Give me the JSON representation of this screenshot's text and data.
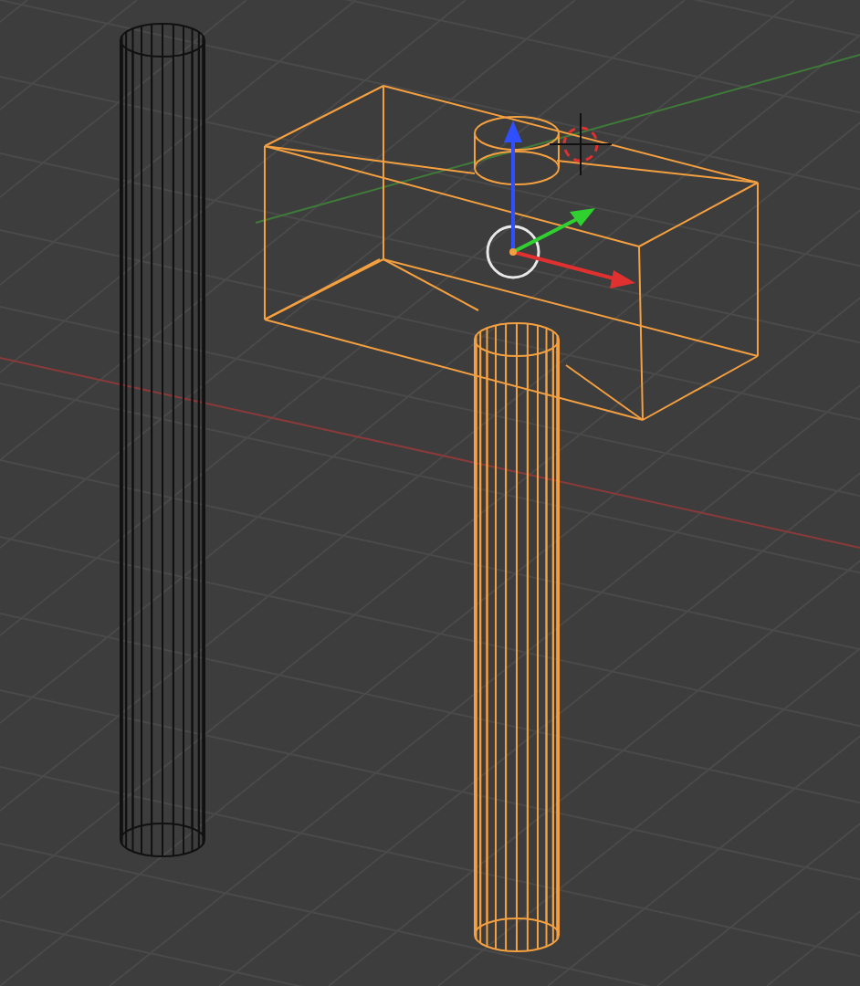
{
  "viewport": {
    "objects": [
      {
        "kind": "cylinder",
        "selected": false
      },
      {
        "kind": "hammer",
        "selected": true
      }
    ]
  }
}
